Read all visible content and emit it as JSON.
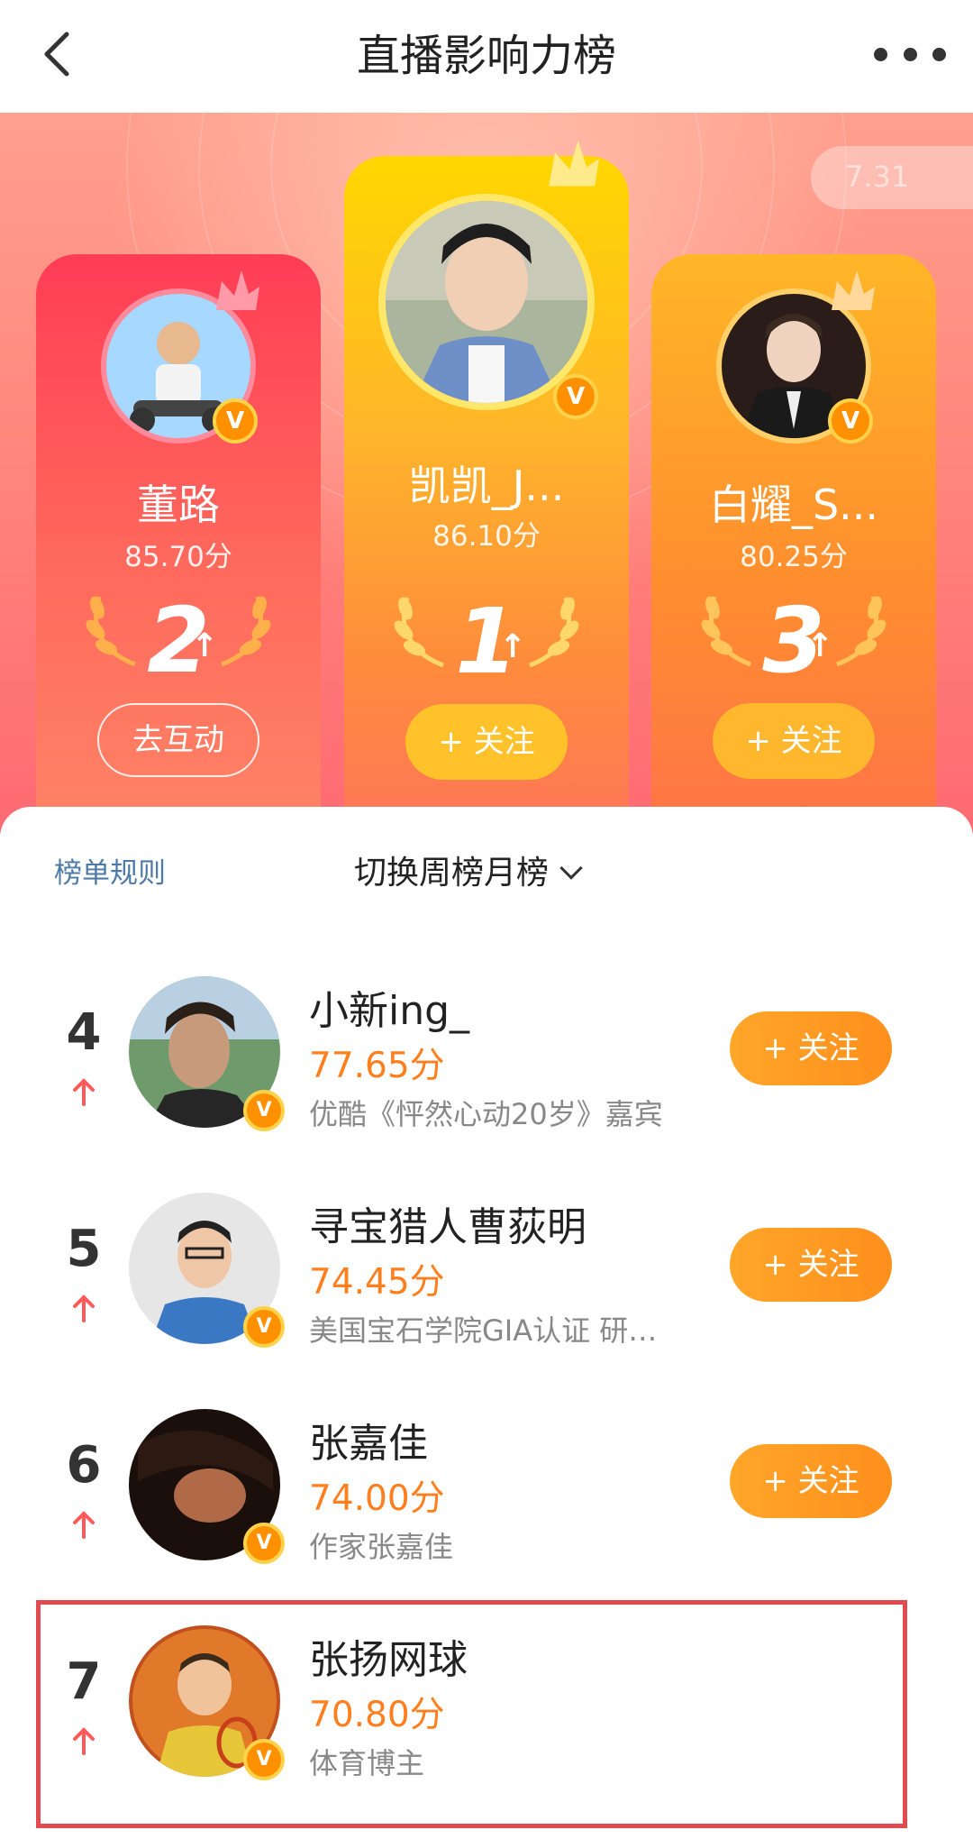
{
  "nav": {
    "title": "直播影响力榜"
  },
  "banner": {
    "period_pill": "7.31"
  },
  "top3": [
    {
      "rank": "2",
      "name": "董路",
      "score": "85.70分",
      "button": "去互动",
      "verified": "V"
    },
    {
      "rank": "1",
      "name": "凯凯_J...",
      "score": "86.10分",
      "button": "+ 关注",
      "verified": "V"
    },
    {
      "rank": "3",
      "name": "白耀_S...",
      "score": "80.25分",
      "button": "+ 关注",
      "verified": "V"
    }
  ],
  "controls": {
    "rules": "榜单规则",
    "switch": "切换周榜月榜"
  },
  "list": [
    {
      "rank": "4",
      "name": "小新ing_",
      "score": "77.65分",
      "desc": "优酷《怦然心动20岁》嘉宾",
      "button": "+ 关注",
      "verified": "V"
    },
    {
      "rank": "5",
      "name": "寻宝猎人曹荻明",
      "score": "74.45分",
      "desc": "美国宝石学院GIA认证 研…",
      "button": "+ 关注",
      "verified": "V"
    },
    {
      "rank": "6",
      "name": "张嘉佳",
      "score": "74.00分",
      "desc": "作家张嘉佳",
      "button": "+ 关注",
      "verified": "V"
    },
    {
      "rank": "7",
      "name": "张扬网球",
      "score": "70.80分",
      "desc": "体育博主",
      "verified": "V"
    }
  ],
  "colors": {
    "accent": "#ff7f1f",
    "highlight_border": "#e24a50",
    "link": "#4e7aa8"
  }
}
